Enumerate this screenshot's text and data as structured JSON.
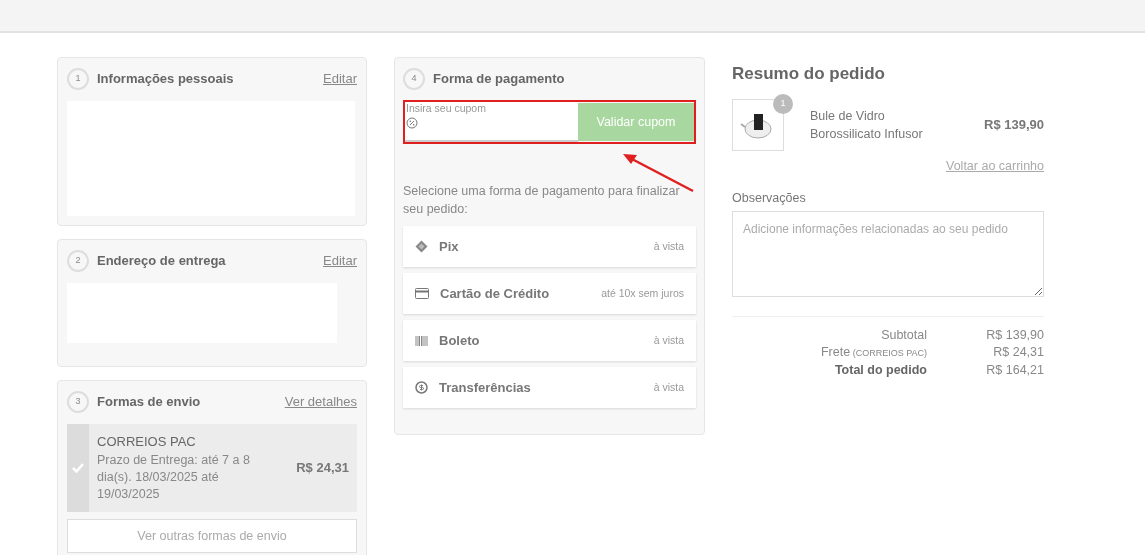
{
  "steps": [
    {
      "number": "1",
      "title": "Informações pessoais",
      "link": "Editar"
    },
    {
      "number": "2",
      "title": "Endereço de entrega",
      "link": "Editar"
    },
    {
      "number": "3",
      "title": "Formas de envio",
      "link": "Ver detalhes"
    }
  ],
  "shipping_options": [
    {
      "name": "CORREIOS PAC",
      "detail": "Prazo de Entrega: até 7 a 8 dia(s). 18/03/2025 até 19/03/2025",
      "price": "R$ 24,31",
      "selected": true
    }
  ],
  "other_shipping_button": "Ver outras formas de envio",
  "payment": {
    "number": "4",
    "title": "Forma de pagamento",
    "coupon": {
      "placeholder": "Insira seu cupom",
      "button": "Validar cupom"
    },
    "instruction": "Selecione uma forma de pagamento para finalizar seu pedido:",
    "methods": [
      {
        "kind": "pix",
        "label": "Pix",
        "terms": "à vista"
      },
      {
        "kind": "card",
        "label": "Cartão de Crédito",
        "terms": "até 10x sem juros"
      },
      {
        "kind": "boleto",
        "label": "Boleto",
        "terms": "à vista"
      },
      {
        "kind": "transfer",
        "label": "Transferências",
        "terms": "à vista"
      }
    ]
  },
  "summary": {
    "title": "Resumo do pedido",
    "items": [
      {
        "quantity": "1",
        "name": "Bule de Vidro Borossilicato Infusor",
        "price": "R$ 139,90"
      }
    ],
    "back_link": "Voltar ao carrinho",
    "notes_label": "Observações",
    "notes_placeholder": "Adicione informações relacionadas ao seu pedido",
    "totals": [
      {
        "label": "Subtotal",
        "value": "R$ 139,90",
        "bold": false
      },
      {
        "label": "Frete",
        "note": "(CORREIOS PAC)",
        "value": "R$ 24,31",
        "bold": false
      },
      {
        "label": "Total do pedido",
        "value": "R$ 164,21",
        "bold": true
      }
    ]
  }
}
